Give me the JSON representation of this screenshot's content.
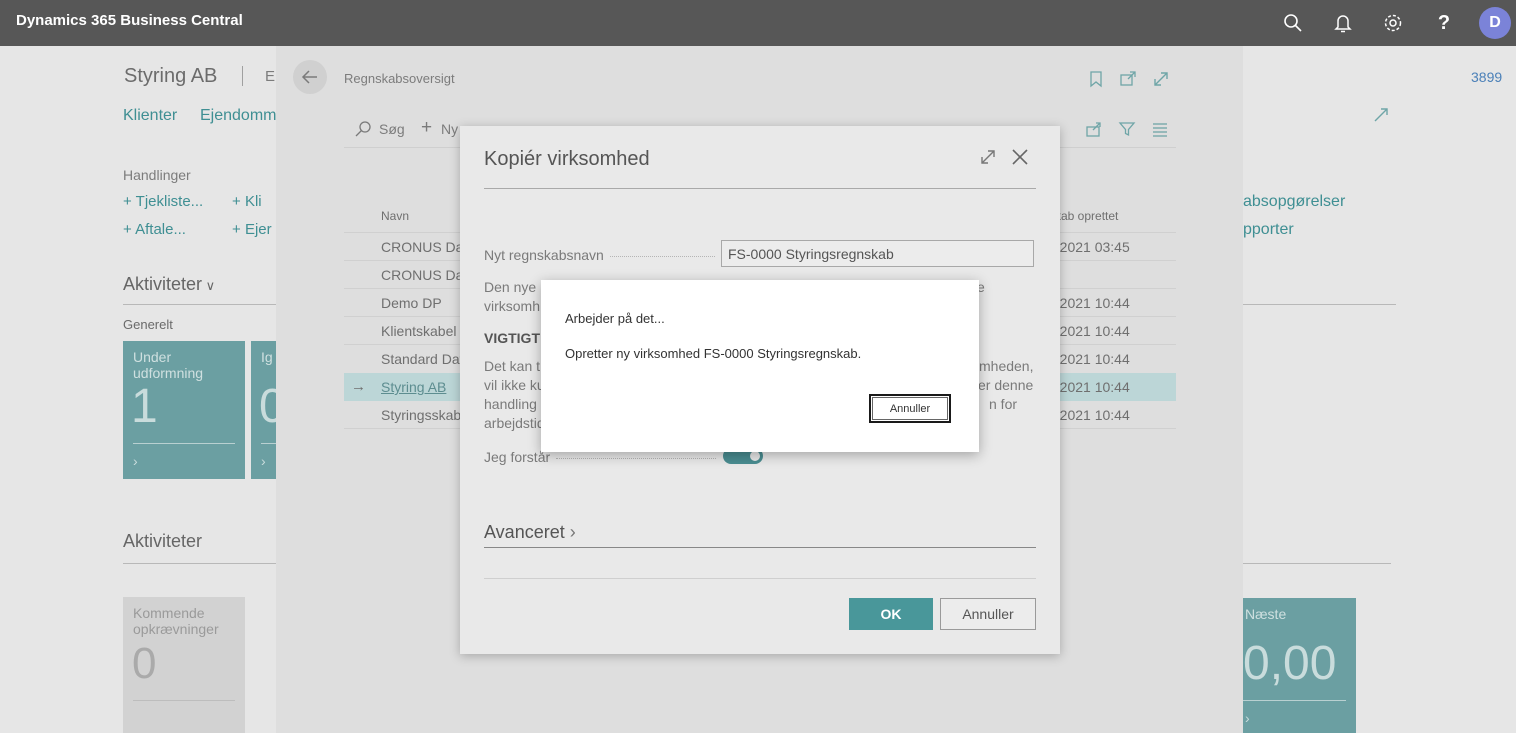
{
  "topbar": {
    "app_title": "Dynamics 365 Business Central",
    "avatar_initial": "D",
    "help_glyph": "?"
  },
  "role_center": {
    "company_name": "Styring AB",
    "company_suffix": "E",
    "nav_clients": "Klienter",
    "nav_properties": "Ejendomm",
    "actions_heading": "Handlinger",
    "action_checklist": "Tjekliste...",
    "action_client": "Kli",
    "action_agreement": "Aftale...",
    "action_prop": "Ejer",
    "activities_heading": "Aktiviteter",
    "general_label": "Generelt",
    "tile_under_label": "Under udformning",
    "tile_under_value": "1",
    "tile_today_label": "Ig",
    "tile_today_value": "0",
    "activities_heading_2": "Aktiviteter",
    "tile_upcoming_label": "Kommende opkrævninger",
    "tile_upcoming_value": "0",
    "right_link_1": "absopgørelser",
    "right_link_2": "pporter",
    "right_number": "3899",
    "tile_next_label": "Næste",
    "tile_next_value": "0,00"
  },
  "list_page": {
    "breadcrumb": "Regnskabsoversigt",
    "search_label": "Søg",
    "new_label": "Ny",
    "col_name": "Navn",
    "col_created": "kab oprettet",
    "rows": [
      {
        "name": "CRONUS Dar",
        "created": "-2021 03:45"
      },
      {
        "name": "CRONUS Dar",
        "created": ""
      },
      {
        "name": "Demo DP",
        "created": "-2021 10:44"
      },
      {
        "name": "Klientskabel",
        "created": "-2021 10:44"
      },
      {
        "name": "Standard Dat",
        "created": "-2021 10:44"
      },
      {
        "name": "Styring AB",
        "created": "-2021 10:44"
      },
      {
        "name": "Styringsskab",
        "created": "-2021 10:44"
      }
    ]
  },
  "copy_dialog": {
    "title": "Kopiér virksomhed",
    "new_name_label": "Nyt regnskabsnavn",
    "new_name_value": "FS-0000 Styringsregnskab",
    "info_line1_a": "Den nye",
    "info_line1_b": "e",
    "info_line2": "virksomh",
    "important_heading": "VIGTIGT",
    "warn_line1_a": "Det kan t",
    "warn_line1_b": "mheden,",
    "warn_line2_a": "vil ikke ku",
    "warn_line2_b": "er denne",
    "warn_line3_a": "handling",
    "warn_line3_b": "n for",
    "warn_line4": "arbejdstid",
    "understand_label": "Jeg forstår",
    "understand_on": true,
    "advanced_label": "Avanceret",
    "ok_label": "OK",
    "cancel_label": "Annuller"
  },
  "progress_dialog": {
    "title": "Arbejder på det...",
    "message": "Opretter ny virksomhed FS-0000 Styringsregnskab.",
    "cancel_label": "Annuller"
  },
  "colors": {
    "topbar": "#575757",
    "accent": "#49979a",
    "avatar": "#7b83d8"
  }
}
